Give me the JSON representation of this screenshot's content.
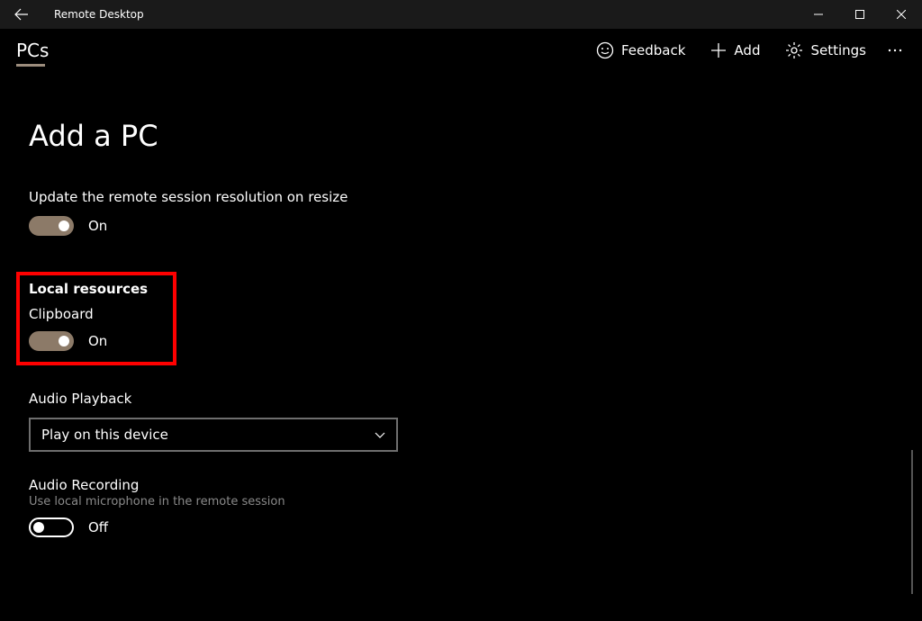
{
  "title": "Remote Desktop",
  "tab": "PCs",
  "commands": {
    "feedback": "Feedback",
    "add": "Add",
    "settings": "Settings"
  },
  "page_heading": "Add a PC",
  "settings": {
    "resolution": {
      "label": "Update the remote session resolution on resize",
      "state": "On"
    },
    "local_resources_heading": "Local resources",
    "clipboard": {
      "label": "Clipboard",
      "state": "On"
    },
    "audio_playback": {
      "label": "Audio Playback",
      "selected": "Play on this device"
    },
    "audio_recording": {
      "label": "Audio Recording",
      "sublabel": "Use local microphone in the remote session",
      "state": "Off"
    }
  }
}
